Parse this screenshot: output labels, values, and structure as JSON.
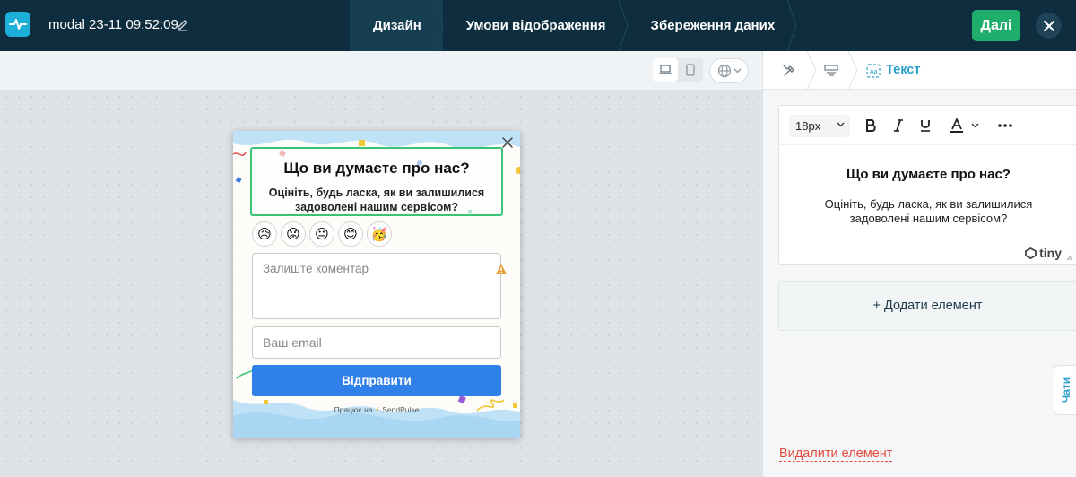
{
  "header": {
    "doc_title": "modal 23-11 09:52:09",
    "steps": [
      {
        "label": "Дизайн",
        "active": true
      },
      {
        "label": "Умови відображення",
        "active": false
      },
      {
        "label": "Збереження даних",
        "active": false
      }
    ],
    "next_label": "Далі"
  },
  "canvas_toolbar": {
    "devices": [
      "desktop-icon",
      "mobile-icon"
    ],
    "active_device": "desktop",
    "language_icon": "globe-icon"
  },
  "popup": {
    "heading": "Що ви думаєте про нас?",
    "subheading": "Оцініть, будь ласка, як ви залишилися задоволені нашим сервісом?",
    "emojis": [
      "😥",
      "😟",
      "😐",
      "😊",
      "🥳"
    ],
    "comment_placeholder": "Залиште коментар",
    "email_placeholder": "Ваш email",
    "submit_label": "Відправити",
    "powered_prefix": "Працює на",
    "powered_brand": "SendPulse"
  },
  "panel": {
    "breadcrumb_current": "Текст",
    "editor": {
      "font_size": "18px",
      "heading": "Що ви думаєте про нас?",
      "body": "Оцініть, будь ласка, як ви залишилися задоволені нашим сервісом?",
      "brand": "tiny"
    },
    "add_element_label": "+ Додати елемент",
    "delete_element_label": "Видалити елемент",
    "chats_label": "Чати"
  },
  "colors": {
    "topbar": "#0e2d3e",
    "accent_green": "#1fad6b",
    "submit_blue": "#2f80e8",
    "link_blue": "#2a9ec9",
    "danger": "#e14b3c"
  }
}
